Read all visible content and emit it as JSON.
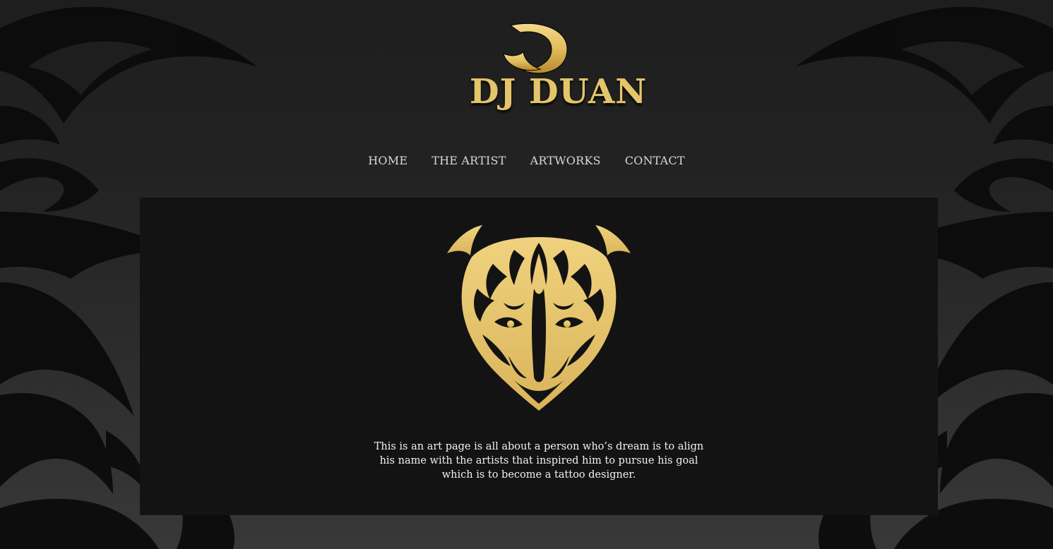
{
  "brand": {
    "name": "DJ DUAN",
    "logo_icon": "dj-monogram-icon",
    "gold": "#e5c56a"
  },
  "nav": {
    "items": [
      {
        "label": "HOME"
      },
      {
        "label": "THE ARTIST"
      },
      {
        "label": "ARTWORKS"
      },
      {
        "label": "CONTACT"
      }
    ]
  },
  "main": {
    "artwork_icon": "tribal-tiger-head-icon",
    "description": "This is an art page is all about a person who’s dream is to align his name with the artists that inspired him to pursue his goal which is to become a tattoo designer."
  },
  "colors": {
    "page_bg": "#222223",
    "panel_bg": "#131313",
    "nav_text": "#d8d8d8",
    "body_text": "#f2f2f2",
    "tribal": "#0b0b0b"
  }
}
